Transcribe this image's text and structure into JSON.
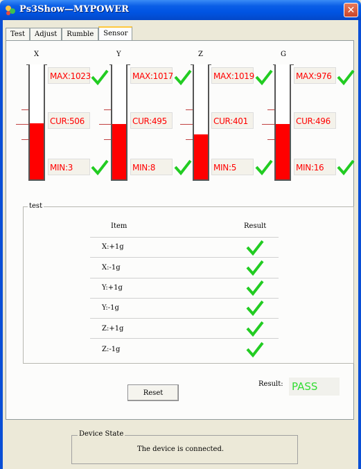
{
  "window": {
    "title": "Ps3Show—MYPOWER",
    "close_glyph": "✕"
  },
  "tabs": [
    {
      "label": "Test"
    },
    {
      "label": "Adjust"
    },
    {
      "label": "Rumble"
    },
    {
      "label": "Sensor",
      "active": true
    }
  ],
  "sensors": [
    {
      "axis": "X",
      "max_label": "MAX:1023",
      "cur_label": "CUR:506",
      "min_label": "MIN:3",
      "max_ok": true,
      "min_ok": true,
      "level": 0.49
    },
    {
      "axis": "Y",
      "max_label": "MAX:1017",
      "cur_label": "CUR:495",
      "min_label": "MIN:8",
      "max_ok": true,
      "min_ok": true,
      "level": 0.48
    },
    {
      "axis": "Z",
      "max_label": "MAX:1019",
      "cur_label": "CUR:401",
      "min_label": "MIN:5",
      "max_ok": true,
      "min_ok": true,
      "level": 0.39
    },
    {
      "axis": "G",
      "max_label": "MAX:976",
      "cur_label": "CUR:496",
      "min_label": "MIN:16",
      "max_ok": true,
      "min_ok": true,
      "level": 0.48
    }
  ],
  "test_group": {
    "title": "test",
    "col_item": "Item",
    "col_result": "Result",
    "rows": [
      {
        "item": "X:+1g",
        "pass": true
      },
      {
        "item": "X:-1g",
        "pass": true
      },
      {
        "item": "Y:+1g",
        "pass": true
      },
      {
        "item": "Y:-1g",
        "pass": true
      },
      {
        "item": "Z:+1g",
        "pass": true
      },
      {
        "item": "Z:-1g",
        "pass": true
      }
    ]
  },
  "reset_label": "Reset",
  "result_label": "Result:",
  "result_value": "PASS",
  "device_state": {
    "title": "Device State",
    "message": "The device is connected."
  },
  "colors": {
    "gauge_fill": "#ff0000",
    "check": "#22cc22",
    "pass": "#33dd33"
  },
  "icons": {
    "check": "check-icon",
    "app": "app-icon",
    "close": "close-icon"
  }
}
